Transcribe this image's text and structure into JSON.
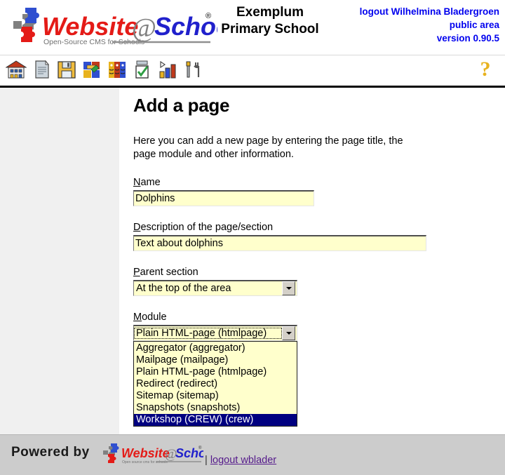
{
  "header": {
    "logo_alt": "Website@School",
    "logo_tagline": "Open-Source CMS for Schools",
    "school_name_line1": "Exemplum",
    "school_name_line2": "Primary School",
    "logout_label": "logout Wilhelmina Bladergroen",
    "area_label": "public area",
    "version_label": "version 0.90.5",
    "link_color": "#0000ee"
  },
  "toolbar": {
    "items": [
      {
        "name": "home-icon",
        "title": "Home"
      },
      {
        "name": "page-icon",
        "title": "Pages"
      },
      {
        "name": "save-disk-icon",
        "title": "File manager"
      },
      {
        "name": "modules-puzzle-icon",
        "title": "Modules"
      },
      {
        "name": "users-icon",
        "title": "Users"
      },
      {
        "name": "checklist-icon",
        "title": "Tasks"
      },
      {
        "name": "statistics-chart-icon",
        "title": "Statistics"
      },
      {
        "name": "tools-icon",
        "title": "Tools"
      }
    ],
    "help_label": "?"
  },
  "main": {
    "page_title": "Add a page",
    "intro": "Here you can add a new page by entering the page title, the page module and other information.",
    "fields": {
      "name": {
        "label_accesskey": "N",
        "label_rest": "ame",
        "value": "Dolphins",
        "placeholder": ""
      },
      "description": {
        "label_accesskey": "D",
        "label_rest": "escription of the page/section",
        "value": "Text about dolphins",
        "placeholder": ""
      },
      "parent_section": {
        "label_accesskey": "P",
        "label_rest": "arent section",
        "value": "At the top of the area"
      },
      "module": {
        "label_accesskey": "M",
        "label_rest": "odule",
        "value": "Plain HTML-page (htmlpage)",
        "options": [
          "Aggregator (aggregator)",
          "Mailpage (mailpage)",
          "Plain HTML-page (htmlpage)",
          "Redirect (redirect)",
          "Sitemap (sitemap)",
          "Snapshots (snapshots)",
          "Workshop (CREW) (crew)"
        ],
        "highlighted_option": "Workshop (CREW) (crew)",
        "highlight_bg": "#000080",
        "list_bg": "#ffffcc"
      }
    },
    "buttons": [
      {
        "name": "save-button",
        "label": ""
      },
      {
        "name": "cancel-button",
        "label": ""
      }
    ]
  },
  "footer": {
    "powered_by": "Powered by",
    "logo_alt": "Website@School",
    "logo_tagline": "Open source cms for schools",
    "separator": "|",
    "logout_link": "logout wblader",
    "background": "#cccccc"
  }
}
